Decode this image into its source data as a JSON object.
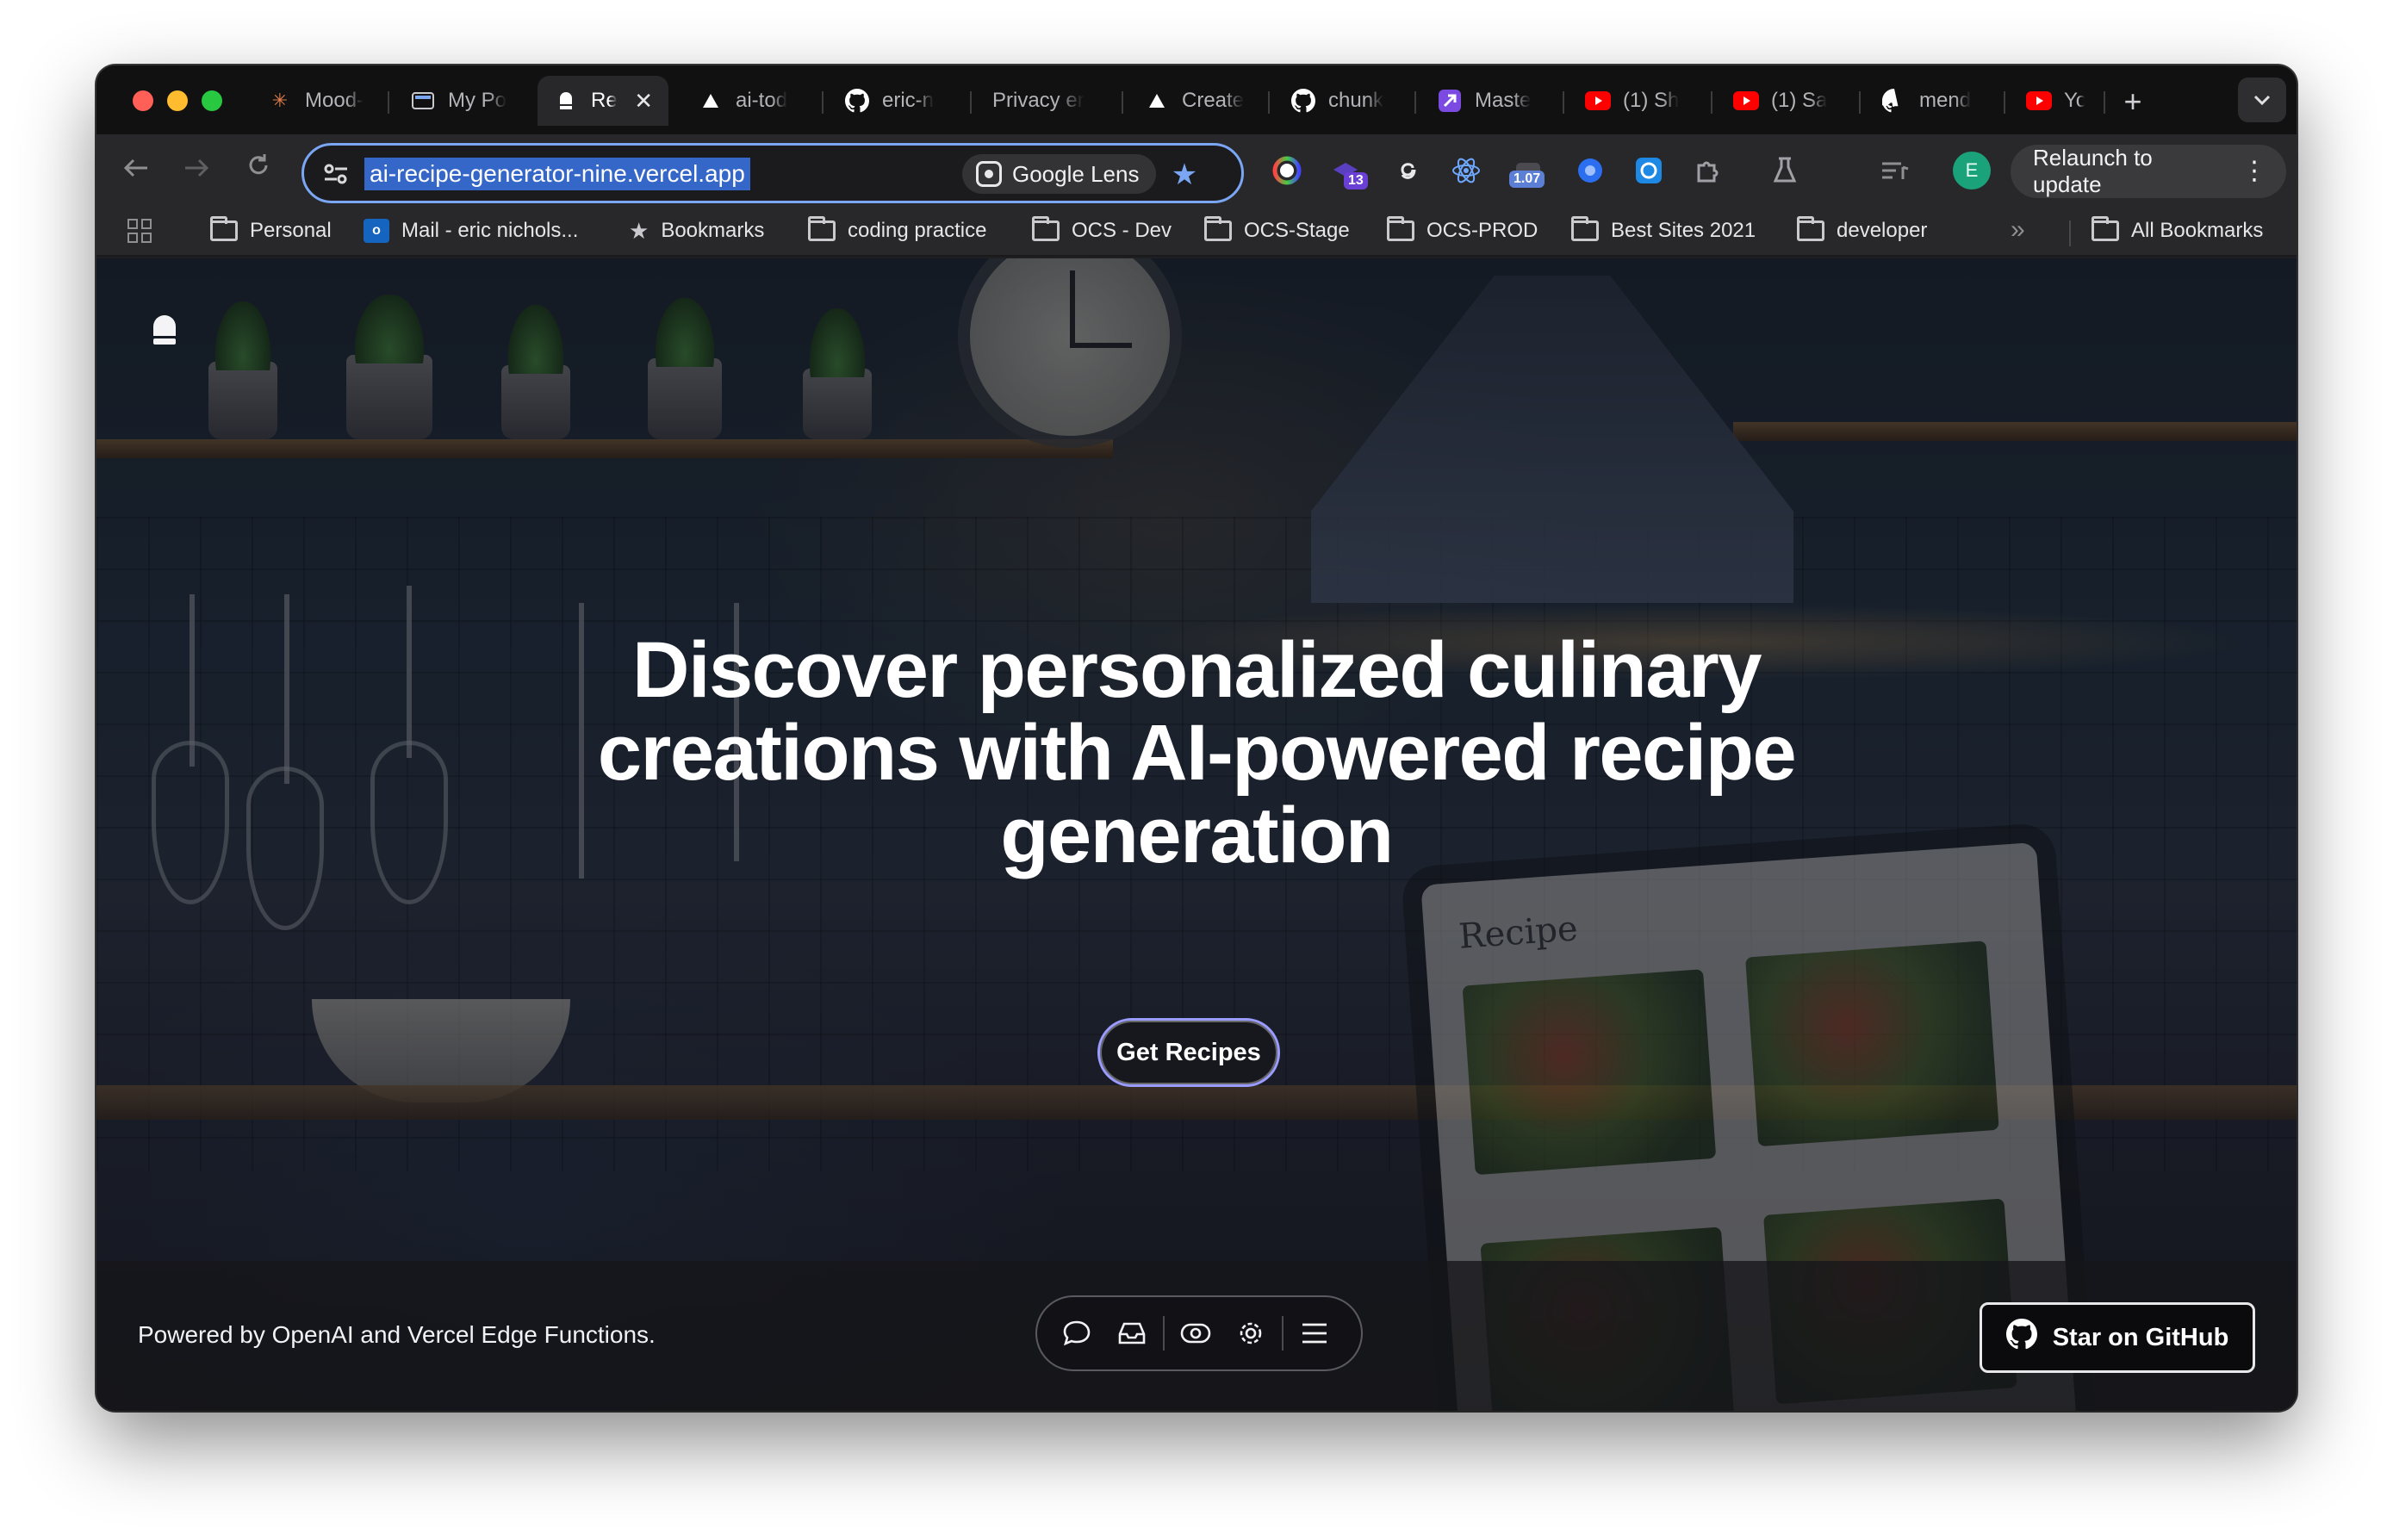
{
  "browser": {
    "tabs": [
      {
        "label": "Mood-",
        "icon": "claude-icon",
        "active": false
      },
      {
        "label": "My Po",
        "icon": "window-icon",
        "active": false
      },
      {
        "label": "Re",
        "icon": "bell-icon",
        "active": true
      },
      {
        "label": "ai-tod",
        "icon": "vercel-icon",
        "active": false
      },
      {
        "label": "eric-n",
        "icon": "github-icon",
        "active": false
      },
      {
        "label": "Privacy er",
        "icon": "none",
        "active": false
      },
      {
        "label": "Create",
        "icon": "vercel-icon",
        "active": false
      },
      {
        "label": "chunk",
        "icon": "github-icon",
        "active": false
      },
      {
        "label": "Maste",
        "icon": "app-icon",
        "active": false
      },
      {
        "label": "(1) Sh",
        "icon": "youtube-icon",
        "active": false
      },
      {
        "label": "(1) Sa",
        "icon": "youtube-icon",
        "active": false
      },
      {
        "label": "mend",
        "icon": "github-icon",
        "active": false
      },
      {
        "label": "YouTu",
        "icon": "youtube-icon",
        "active": false
      }
    ],
    "tab_close": "✕",
    "new_tab": "+",
    "url": "ai-recipe-generator-nine.vercel.app",
    "lens_label": "Google Lens",
    "extension_badges": {
      "notifications": "13",
      "version": "1.07"
    },
    "avatar_initial": "E",
    "relaunch_label": "Relaunch to update",
    "bookmarks": [
      {
        "label": "Personal",
        "icon": "folder-icon"
      },
      {
        "label": "Mail - eric nichols...",
        "icon": "outlook-icon"
      },
      {
        "label": "Bookmarks",
        "icon": "star-icon"
      },
      {
        "label": "coding practice",
        "icon": "folder-icon"
      },
      {
        "label": "OCS - Dev",
        "icon": "folder-icon"
      },
      {
        "label": "OCS-Stage",
        "icon": "folder-icon"
      },
      {
        "label": "OCS-PROD",
        "icon": "folder-icon"
      },
      {
        "label": "Best Sites 2021",
        "icon": "folder-icon"
      },
      {
        "label": "developer",
        "icon": "folder-icon"
      }
    ],
    "all_bookmarks": "All Bookmarks"
  },
  "page": {
    "hero_title": "Discover personalized culinary creations with AI-powered recipe generation",
    "cta_label": "Get Recipes",
    "footer_text": "Powered by OpenAI and Vercel Edge Functions.",
    "github_label": "Star on GitHub",
    "background_tablet_text": "Recipe"
  },
  "colors": {
    "accent": "#7aa6f4",
    "cta_border": "#9a9cff",
    "url_highlight": "#3567c8"
  }
}
